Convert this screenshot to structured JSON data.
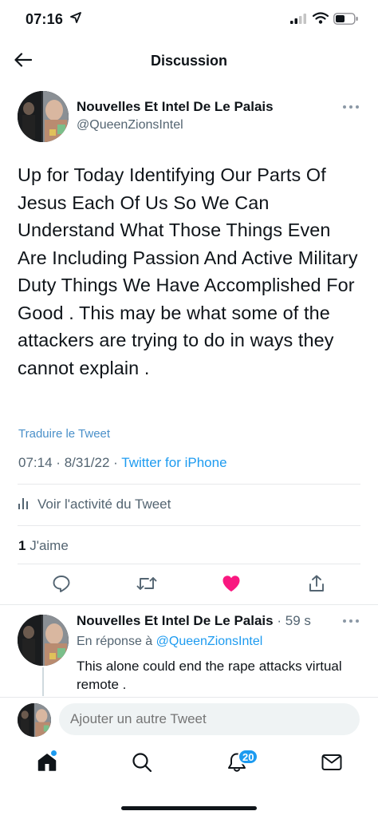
{
  "status_bar": {
    "time": "07:16",
    "location_icon": "location-arrow-icon",
    "signal_icon": "cell-signal-icon",
    "wifi_icon": "wifi-icon",
    "battery_icon": "battery-icon"
  },
  "nav": {
    "back_icon": "back-arrow-icon",
    "title": "Discussion"
  },
  "tweet": {
    "author_name": "Nouvelles Et Intel De Le Palais",
    "handle": "@QueenZionsIntel",
    "text": "Up for Today Identifying Our Parts Of Jesus Each Of Us So We Can Understand What Those Things Even Are Including Passion And Active Military Duty Things We Have Accomplished For Good .  This may be what some of the attackers are trying to do in ways they cannot explain .",
    "translate_label": "Traduire le Tweet",
    "time": "07:14",
    "date": "8/31/22",
    "separator": "·",
    "source": "Twitter for iPhone",
    "activity_label": "Voir l'activité du Tweet",
    "likes_count": "1",
    "likes_label": "J'aime",
    "liked": true
  },
  "actions": {
    "reply_icon": "reply-icon",
    "retweet_icon": "retweet-icon",
    "like_icon": "heart-icon",
    "share_icon": "share-icon"
  },
  "reply": {
    "author_name": "Nouvelles Et Intel De Le Palais",
    "time_sep": "·",
    "time": "59 s",
    "in_reply_label": "En réponse à",
    "in_reply_handle": "@QueenZionsIntel",
    "text": "This alone could end the rape attacks virtual remote ."
  },
  "compose": {
    "placeholder": "Ajouter un autre Tweet"
  },
  "tab_bar": {
    "home_icon": "home-icon",
    "search_icon": "search-icon",
    "notifications_icon": "bell-icon",
    "notifications_count": "20",
    "messages_icon": "mail-icon"
  },
  "colors": {
    "accent": "#1d9bf0",
    "like": "#f91880",
    "secondary_text": "#536471",
    "primary_text": "#0f1419"
  }
}
